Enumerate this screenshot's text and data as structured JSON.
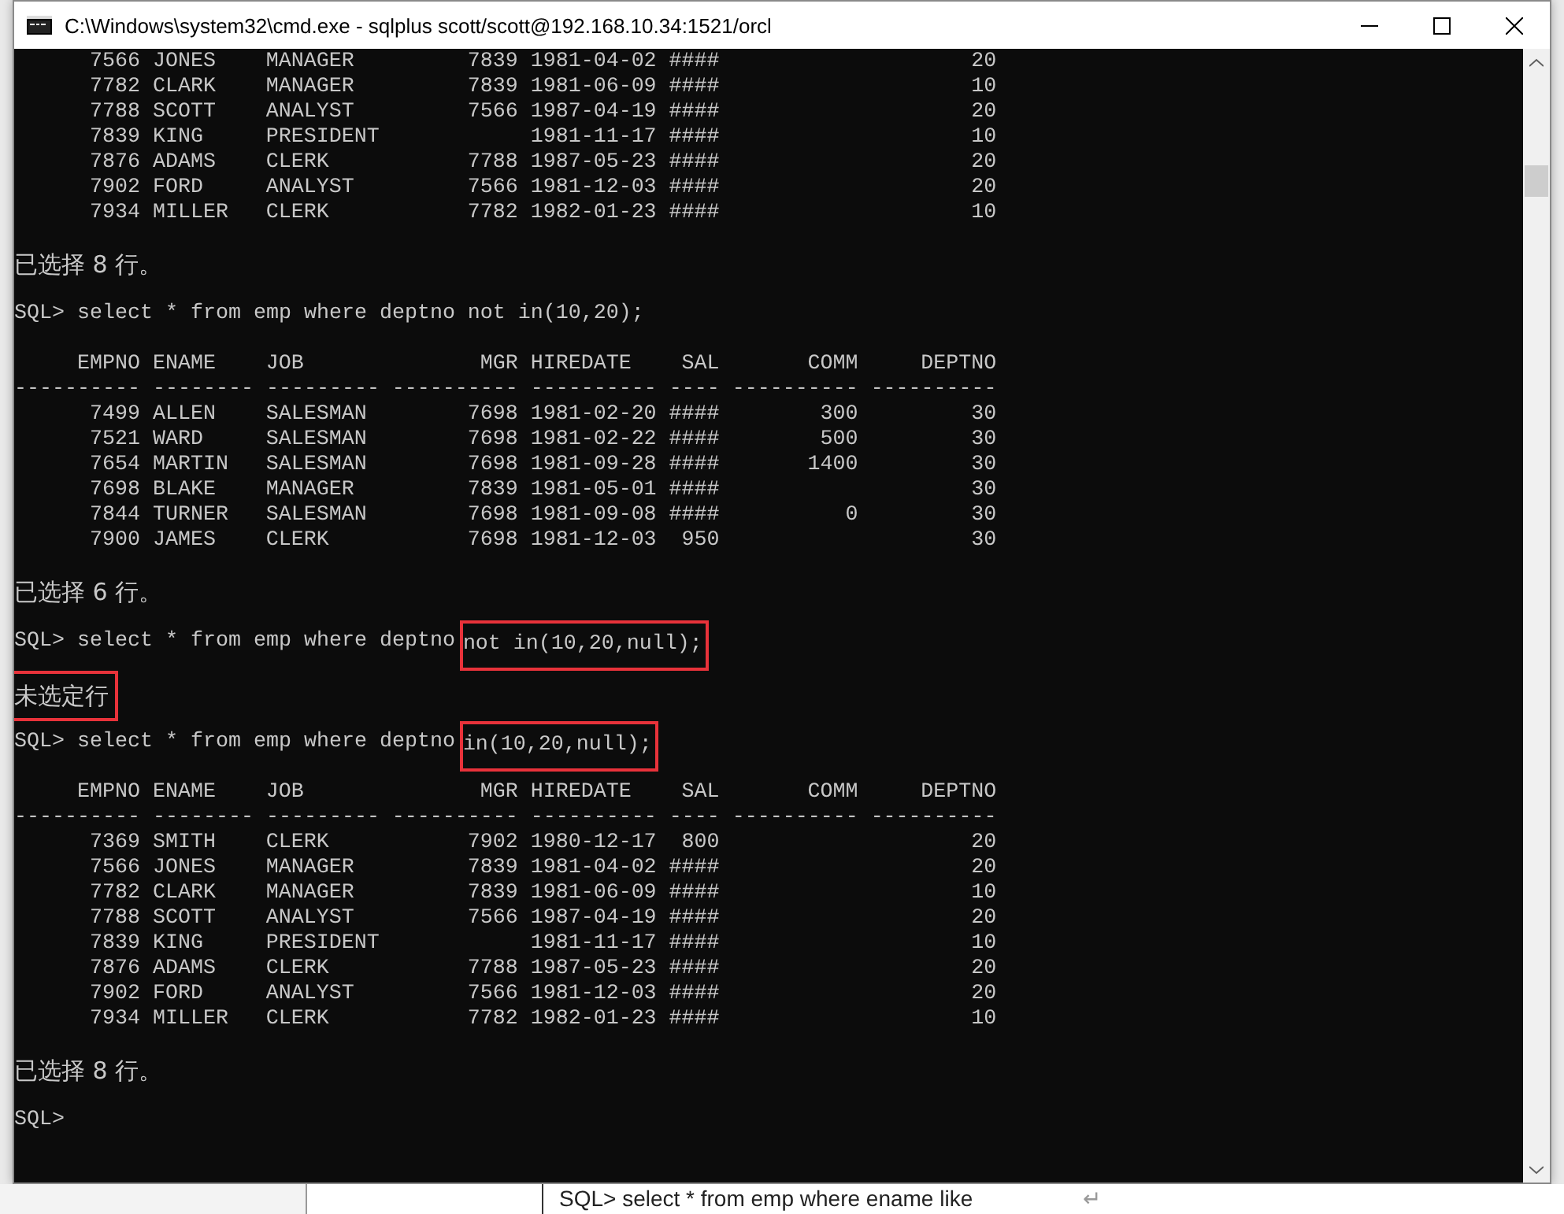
{
  "window": {
    "title": "C:\\Windows\\system32\\cmd.exe - sqlplus  scott/scott@192.168.10.34:1521/orcl"
  },
  "console": [
    {
      "kind": "table",
      "rows": [
        [
          "7566",
          "JONES",
          "MANAGER",
          "7839",
          "1981-04-02",
          "####",
          null,
          "20"
        ],
        [
          "7782",
          "CLARK",
          "MANAGER",
          "7839",
          "1981-06-09",
          "####",
          null,
          "10"
        ],
        [
          "7788",
          "SCOTT",
          "ANALYST",
          "7566",
          "1987-04-19",
          "####",
          null,
          "20"
        ],
        [
          "7839",
          "KING",
          "PRESIDENT",
          null,
          "1981-11-17",
          "####",
          null,
          "10"
        ],
        [
          "7876",
          "ADAMS",
          "CLERK",
          "7788",
          "1987-05-23",
          "####",
          null,
          "20"
        ],
        [
          "7902",
          "FORD",
          "ANALYST",
          "7566",
          "1981-12-03",
          "####",
          null,
          "20"
        ],
        [
          "7934",
          "MILLER",
          "CLERK",
          "7782",
          "1982-01-23",
          "####",
          null,
          "10"
        ]
      ]
    },
    {
      "kind": "message",
      "text": "已选择 8 行。",
      "highlighted": false
    },
    {
      "kind": "command",
      "text": "SQL> select * from emp where deptno not in(10,20);"
    },
    {
      "kind": "table",
      "columns": [
        {
          "header": "EMPNO",
          "rule": "----------"
        },
        {
          "header": "ENAME",
          "rule": "--------"
        },
        {
          "header": "JOB",
          "rule": "---------"
        },
        {
          "header": "MGR",
          "rule": "----------"
        },
        {
          "header": "HIREDATE",
          "rule": "----------"
        },
        {
          "header": "SAL",
          "rule": "----"
        },
        {
          "header": "COMM",
          "rule": "----------"
        },
        {
          "header": "DEPTNO",
          "rule": "----------"
        }
      ],
      "rows": [
        [
          "7499",
          "ALLEN",
          "SALESMAN",
          "7698",
          "1981-02-20",
          "####",
          "300",
          "30"
        ],
        [
          "7521",
          "WARD",
          "SALESMAN",
          "7698",
          "1981-02-22",
          "####",
          "500",
          "30"
        ],
        [
          "7654",
          "MARTIN",
          "SALESMAN",
          "7698",
          "1981-09-28",
          "####",
          "1400",
          "30"
        ],
        [
          "7698",
          "BLAKE",
          "MANAGER",
          "7839",
          "1981-05-01",
          "####",
          null,
          "30"
        ],
        [
          "7844",
          "TURNER",
          "SALESMAN",
          "7698",
          "1981-09-08",
          "####",
          "0",
          "30"
        ],
        [
          "7900",
          "JAMES",
          "CLERK",
          "7698",
          "1981-12-03",
          "950",
          null,
          "30"
        ]
      ]
    },
    {
      "kind": "message",
      "text": "已选择 6 行。",
      "highlighted": false
    },
    {
      "kind": "command",
      "text": "SQL> select * from emp where deptno",
      "highlight": "not in(10,20,null);"
    },
    {
      "kind": "message",
      "text": "未选定行",
      "highlighted": true
    },
    {
      "kind": "command",
      "text": "SQL> select * from emp where deptno",
      "highlight": "in(10,20,null);"
    },
    {
      "kind": "table",
      "columns": [
        {
          "header": "EMPNO",
          "rule": "----------"
        },
        {
          "header": "ENAME",
          "rule": "--------"
        },
        {
          "header": "JOB",
          "rule": "---------"
        },
        {
          "header": "MGR",
          "rule": "----------"
        },
        {
          "header": "HIREDATE",
          "rule": "----------"
        },
        {
          "header": "SAL",
          "rule": "----"
        },
        {
          "header": "COMM",
          "rule": "----------"
        },
        {
          "header": "DEPTNO",
          "rule": "----------"
        }
      ],
      "rows": [
        [
          "7369",
          "SMITH",
          "CLERK",
          "7902",
          "1980-12-17",
          "800",
          null,
          "20"
        ],
        [
          "7566",
          "JONES",
          "MANAGER",
          "7839",
          "1981-04-02",
          "####",
          null,
          "20"
        ],
        [
          "7782",
          "CLARK",
          "MANAGER",
          "7839",
          "1981-06-09",
          "####",
          null,
          "10"
        ],
        [
          "7788",
          "SCOTT",
          "ANALYST",
          "7566",
          "1987-04-19",
          "####",
          null,
          "20"
        ],
        [
          "7839",
          "KING",
          "PRESIDENT",
          null,
          "1981-11-17",
          "####",
          null,
          "10"
        ],
        [
          "7876",
          "ADAMS",
          "CLERK",
          "7788",
          "1987-05-23",
          "####",
          null,
          "20"
        ],
        [
          "7902",
          "FORD",
          "ANALYST",
          "7566",
          "1981-12-03",
          "####",
          null,
          "20"
        ],
        [
          "7934",
          "MILLER",
          "CLERK",
          "7782",
          "1982-01-23",
          "####",
          null,
          "10"
        ]
      ]
    },
    {
      "kind": "message",
      "text": "已选择 8 行。",
      "highlighted": false
    },
    {
      "kind": "command",
      "text": "SQL>"
    }
  ],
  "background_window": {
    "text": "SQL> select * from emp where ename like",
    "mark": "↵"
  }
}
